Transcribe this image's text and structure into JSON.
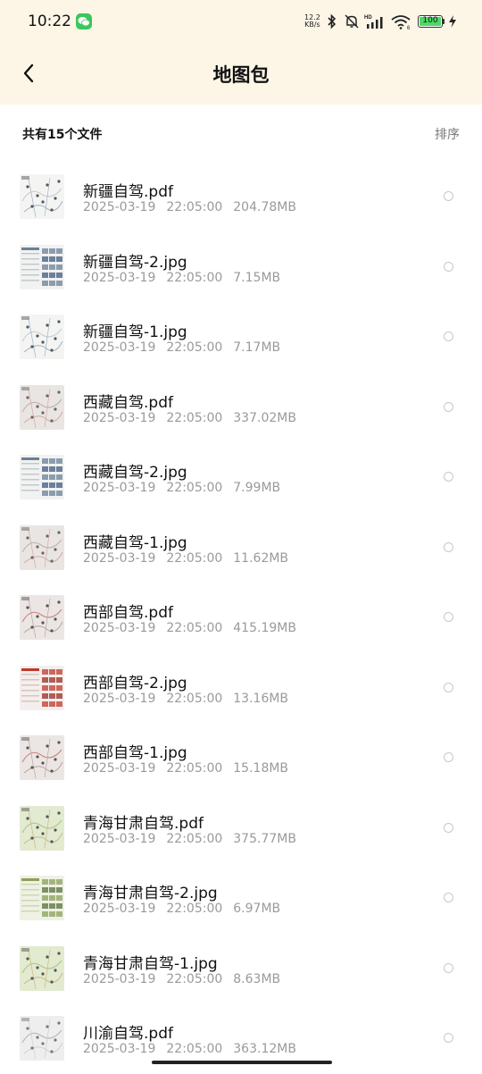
{
  "status_bar": {
    "time": "10:22",
    "net_speed_value": "12.2",
    "net_speed_unit": "KB/s",
    "battery": "100",
    "icons": [
      "wechat-icon",
      "bluetooth-icon",
      "mute-icon",
      "signal-icon",
      "wifi-icon",
      "battery-icon",
      "charging-icon"
    ]
  },
  "header": {
    "title": "地图包",
    "back_icon": "chevron-left-icon"
  },
  "summary": {
    "count_text": "共有15个文件",
    "sort_label": "排序"
  },
  "colors": {
    "header_bg": "#fdf6e7",
    "meta_text": "#9a9a9a"
  },
  "files": [
    {
      "name": "新疆自驾.pdf",
      "date": "2025-03-19",
      "time": "22:05:00",
      "size": "204.78MB",
      "thumb": "map-white"
    },
    {
      "name": "新疆自驾-2.jpg",
      "date": "2025-03-19",
      "time": "22:05:00",
      "size": "7.15MB",
      "thumb": "guide"
    },
    {
      "name": "新疆自驾-1.jpg",
      "date": "2025-03-19",
      "time": "22:05:00",
      "size": "7.17MB",
      "thumb": "map-white"
    },
    {
      "name": "西藏自驾.pdf",
      "date": "2025-03-19",
      "time": "22:05:00",
      "size": "337.02MB",
      "thumb": "map-grey"
    },
    {
      "name": "西藏自驾-2.jpg",
      "date": "2025-03-19",
      "time": "22:05:00",
      "size": "7.99MB",
      "thumb": "guide"
    },
    {
      "name": "西藏自驾-1.jpg",
      "date": "2025-03-19",
      "time": "22:05:00",
      "size": "11.62MB",
      "thumb": "map-grey"
    },
    {
      "name": "西部自驾.pdf",
      "date": "2025-03-19",
      "time": "22:05:00",
      "size": "415.19MB",
      "thumb": "map-red"
    },
    {
      "name": "西部自驾-2.jpg",
      "date": "2025-03-19",
      "time": "22:05:00",
      "size": "13.16MB",
      "thumb": "guide-red"
    },
    {
      "name": "西部自驾-1.jpg",
      "date": "2025-03-19",
      "time": "22:05:00",
      "size": "15.18MB",
      "thumb": "map-red"
    },
    {
      "name": "青海甘肃自驾.pdf",
      "date": "2025-03-19",
      "time": "22:05:00",
      "size": "375.77MB",
      "thumb": "map-green"
    },
    {
      "name": "青海甘肃自驾-2.jpg",
      "date": "2025-03-19",
      "time": "22:05:00",
      "size": "6.97MB",
      "thumb": "guide-green"
    },
    {
      "name": "青海甘肃自驾-1.jpg",
      "date": "2025-03-19",
      "time": "22:05:00",
      "size": "8.63MB",
      "thumb": "map-green"
    },
    {
      "name": "川渝自驾.pdf",
      "date": "2025-03-19",
      "time": "22:05:00",
      "size": "363.12MB",
      "thumb": "map-lines"
    }
  ]
}
